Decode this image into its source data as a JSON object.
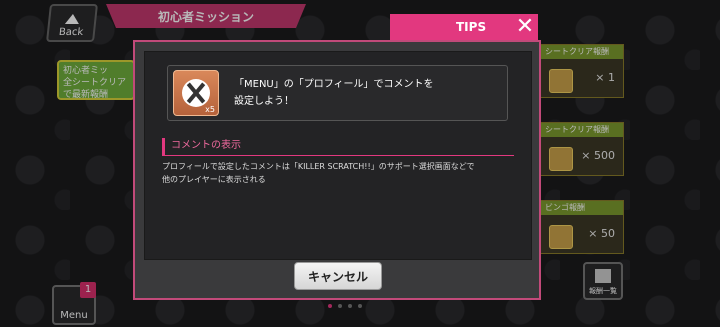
{
  "header": {
    "back_label": "Back",
    "screen_title": "初心者ミッション",
    "tips_label": "TIPS"
  },
  "background": {
    "left_chip_title": "初心者ミッ",
    "left_chip_sub": "全シートクリアで最新報酬",
    "rewards": [
      {
        "header": "シートクリア報酬",
        "value": "× 1"
      },
      {
        "header": "シートクリア報酬",
        "value": "× 500"
      },
      {
        "header": "ビンゴ報酬",
        "value": "× 50"
      }
    ],
    "menu_label": "Menu",
    "menu_badge": "1",
    "reward_list_label": "報酬一覧"
  },
  "modal": {
    "mission_text_line1": "「MENU」の「プロフィール」でコメントを",
    "mission_text_line2": "設定しよう！",
    "item_qty": "x5",
    "section_title": "コメントの表示",
    "description_line1": "プロフィールで設定したコメントは「KILLER SCRATCH!!」のサポート選択画面などで",
    "description_line2": "他のプレイヤーに表示される",
    "cancel_label": "キャンセル"
  },
  "colors": {
    "accent": "#e2387f",
    "modal_border": "#c24a7a"
  }
}
